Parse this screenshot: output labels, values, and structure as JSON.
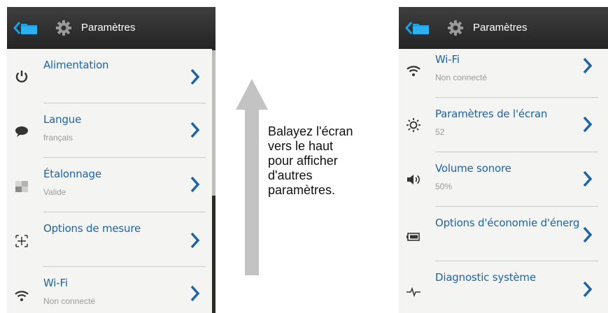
{
  "left_screen": {
    "header": {
      "title": "Paramètres"
    },
    "items": [
      {
        "label": "Alimentation",
        "sublabel": "",
        "icon": "power-icon"
      },
      {
        "label": "Langue",
        "sublabel": "français",
        "icon": "speech-bubble-icon"
      },
      {
        "label": "Étalonnage",
        "sublabel": "Valide",
        "icon": "calibration-icon"
      },
      {
        "label": "Options de mesure",
        "sublabel": "",
        "icon": "crosshair-icon"
      },
      {
        "label": "Wi-Fi",
        "sublabel": "Non connecté",
        "icon": "wifi-icon"
      }
    ]
  },
  "right_screen": {
    "header": {
      "title": "Paramètres"
    },
    "items": [
      {
        "label": "Wi-Fi",
        "sublabel": "Non connecté",
        "icon": "wifi-icon"
      },
      {
        "label": "Paramètres de l'écran",
        "sublabel": "52",
        "icon": "brightness-icon"
      },
      {
        "label": "Volume sonore",
        "sublabel": "50%",
        "icon": "speaker-icon"
      },
      {
        "label": "Options d'économie d'énerg",
        "sublabel": "",
        "icon": "battery-icon"
      },
      {
        "label": "Diagnostic système",
        "sublabel": "",
        "icon": "pulse-icon"
      }
    ]
  },
  "instruction": "Balayez l'écran\nvers le haut\npour afficher\nd'autres\nparamètres.",
  "colors": {
    "header_bg": "#2f2f2f",
    "accent_blue": "#1c63a8",
    "folder_blue": "#1aa0e6",
    "arrow_gray": "#c3c3c3"
  }
}
